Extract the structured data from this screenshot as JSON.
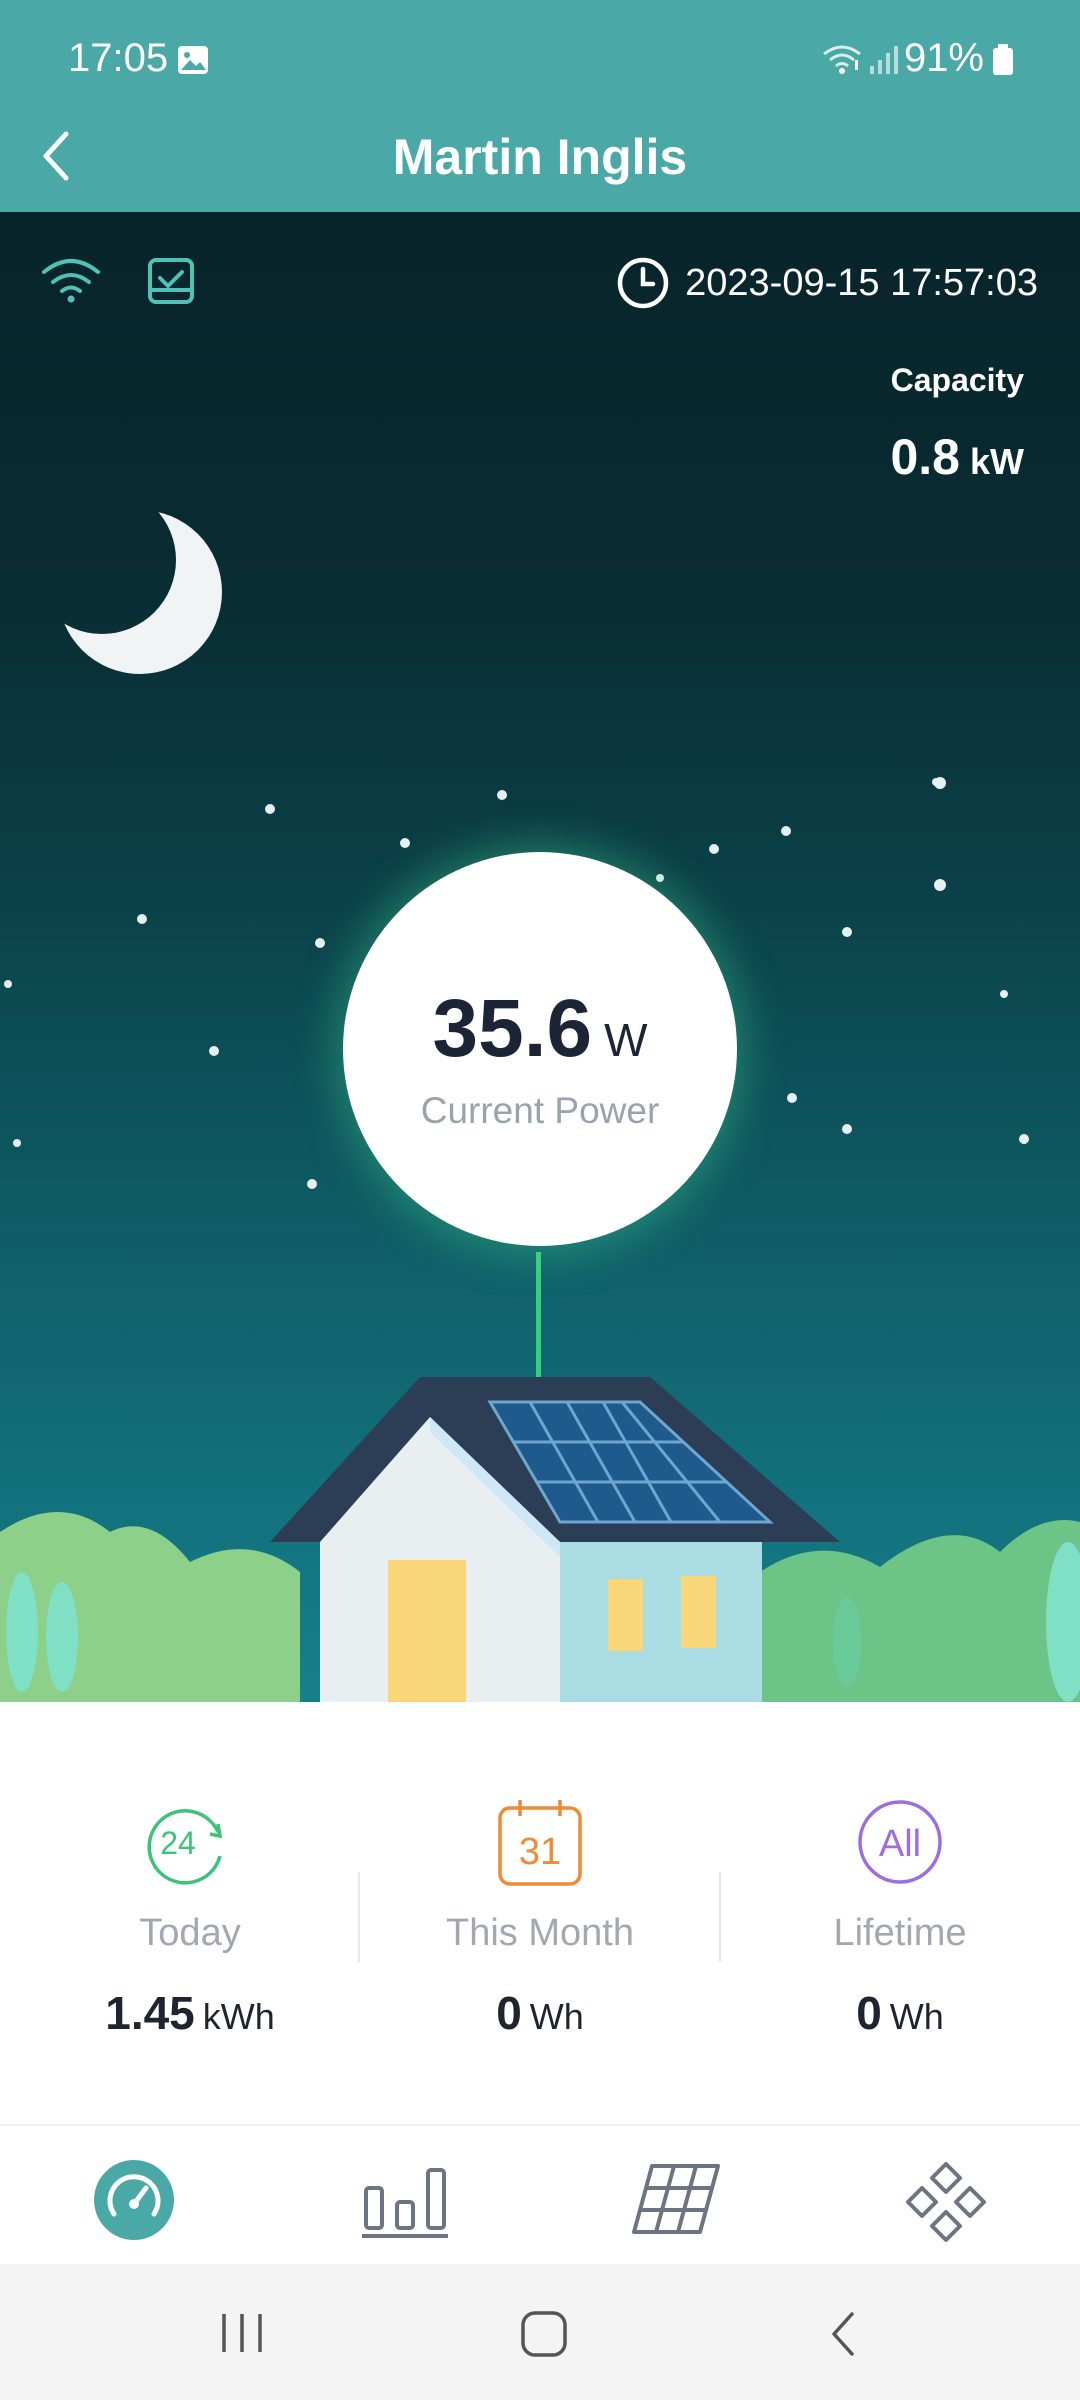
{
  "status_bar": {
    "time": "17:05",
    "battery": "91%"
  },
  "app_bar": {
    "title": "Martin Inglis"
  },
  "scene": {
    "timestamp": "2023-09-15 17:57:03",
    "capacity_label": "Capacity",
    "capacity_value": "0.8",
    "capacity_unit": "kW",
    "power_value": "35.6",
    "power_unit": "W",
    "power_label": "Current Power"
  },
  "stats": [
    {
      "icon": "clock-24h-icon",
      "icon_text": "24",
      "label": "Today",
      "value": "1.45",
      "unit": "kWh",
      "color": "#3cc37a"
    },
    {
      "icon": "calendar-icon",
      "icon_text": "31",
      "label": "This Month",
      "value": "0",
      "unit": "Wh",
      "color": "#ef8a35"
    },
    {
      "icon": "all-icon",
      "icon_text": "All",
      "label": "Lifetime",
      "value": "0",
      "unit": "Wh",
      "color": "#9b6de0"
    }
  ],
  "tabs": [
    "dashboard-icon",
    "chart-icon",
    "solar-panel-icon",
    "devices-icon"
  ],
  "colors": {
    "accent": "#4aa9a6",
    "stat_today": "#3cc37a",
    "stat_month": "#ef8a35",
    "stat_lifetime": "#9b6de0"
  }
}
